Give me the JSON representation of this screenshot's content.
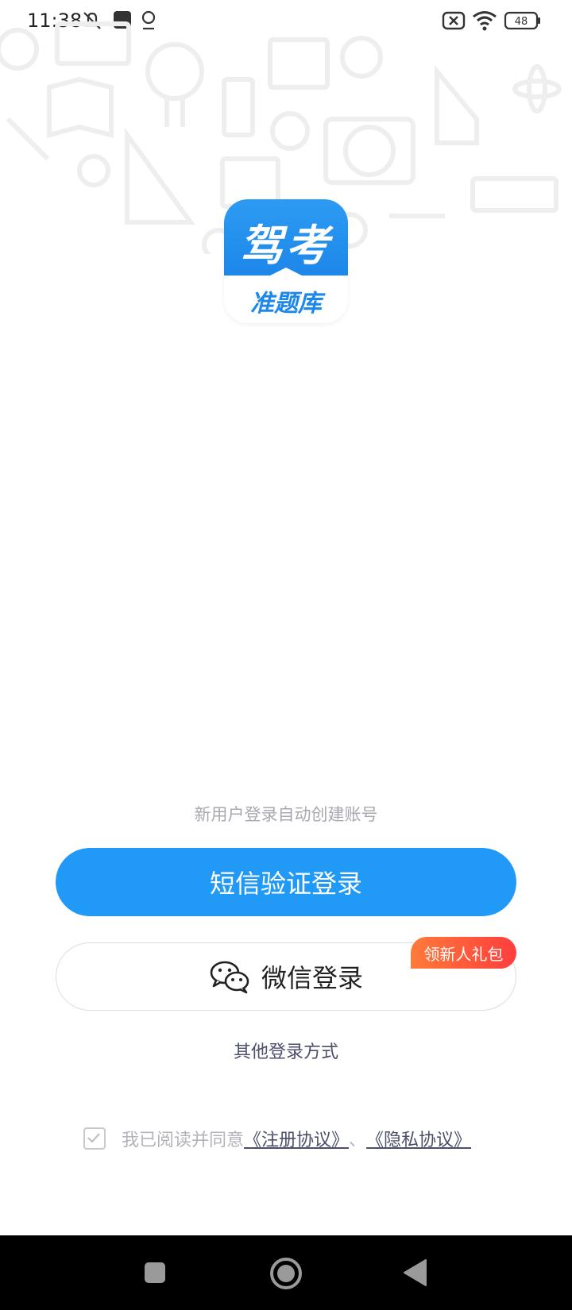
{
  "status_bar": {
    "time": "11:38",
    "battery_level": "48"
  },
  "logo": {
    "title": "驾考",
    "subtitle": "准题库"
  },
  "login": {
    "hint": "新用户登录自动创建账号",
    "sms_button": "短信验证登录",
    "wechat_button": "微信登录",
    "gift_badge": "领新人礼包",
    "other_methods": "其他登录方式"
  },
  "agreement": {
    "prefix": "我已阅读并同意",
    "register_link": "《注册协议》",
    "separator": "、",
    "privacy_link": "《隐私协议》",
    "checked": true
  },
  "colors": {
    "primary": "#2199f7",
    "badge": "#ff4d3d",
    "link": "#4b4f6b"
  },
  "icons": {
    "status": [
      "mute-icon",
      "notification-square-icon",
      "location-icon",
      "sim-off-icon",
      "wifi-icon",
      "battery-icon"
    ],
    "nav": [
      "recents-icon",
      "home-icon",
      "back-icon"
    ]
  }
}
